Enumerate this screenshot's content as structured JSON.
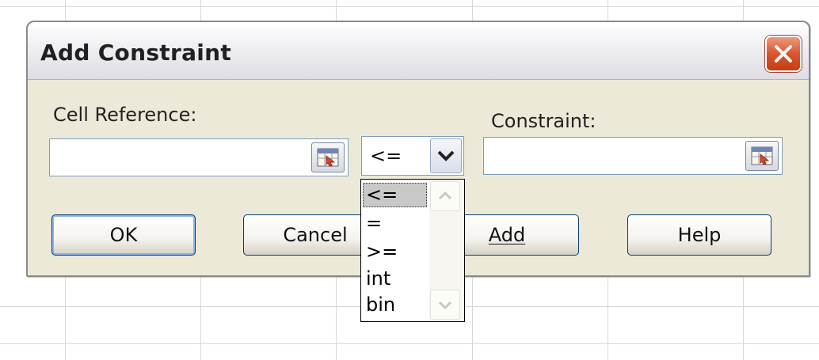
{
  "dialog": {
    "title": "Add Constraint",
    "close_icon": "close-x-icon"
  },
  "cell_reference": {
    "label": "Cell Reference:",
    "value": "",
    "ref_icon": "range-select-icon"
  },
  "operator": {
    "selected": "<=",
    "options": [
      "<=",
      "=",
      ">=",
      "int",
      "bin"
    ]
  },
  "constraint": {
    "label": "Constraint:",
    "value": "",
    "ref_icon": "range-select-icon"
  },
  "buttons": {
    "ok": "OK",
    "cancel": "Cancel",
    "add": "Add",
    "help": "Help"
  },
  "colors": {
    "dialog_bg": "#ece9d8",
    "close_button": "#d8562e",
    "button_border": "#003c74",
    "selected_option_bg": "#c8c8c8"
  }
}
